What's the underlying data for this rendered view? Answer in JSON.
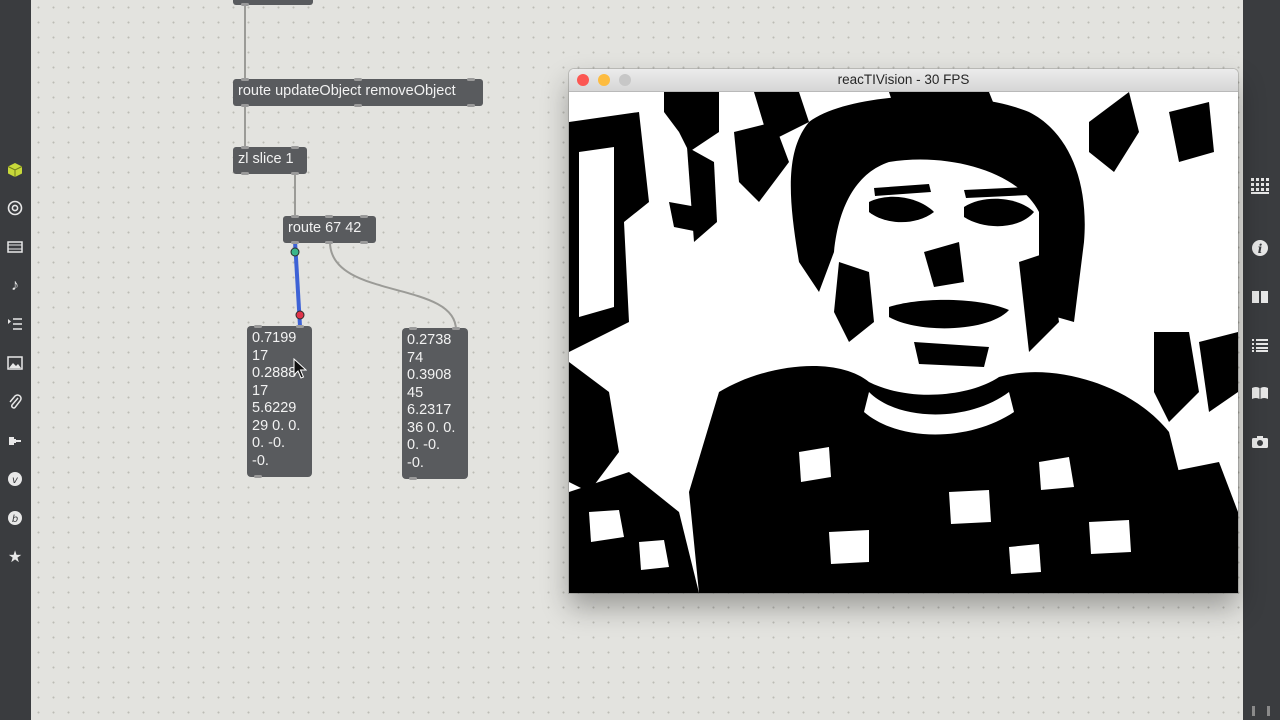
{
  "sidebar_left": {
    "icons": [
      "cube-icon",
      "target-icon",
      "film-icon",
      "music-note-icon",
      "step-list-icon",
      "image-icon",
      "paperclip-icon",
      "plugin-icon",
      "vst-icon",
      "beap-icon",
      "star-icon"
    ]
  },
  "sidebar_right": {
    "icons": [
      "grid-icon",
      "info-icon",
      "split-view-icon",
      "list-icon",
      "book-icon",
      "snapshot-icon"
    ]
  },
  "patch": {
    "objects": {
      "route_update": "route updateObject removeObject",
      "zl_slice": "zl slice 1",
      "route_67_42": "route 67 42"
    },
    "message_left": [
      "0.7199",
      "17",
      "0.2888",
      "17",
      "5.6229",
      "29 0. 0.",
      "0. -0.",
      "-0."
    ],
    "message_right": [
      "0.2738",
      "74",
      "0.3908",
      "45",
      "6.2317",
      "36 0. 0.",
      "0. -0.",
      "-0."
    ]
  },
  "video_window": {
    "title": "reacTIVision - 30 FPS",
    "colors": {
      "close": "#fc5753",
      "minimize": "#fdbc40",
      "zoom": "#c7c7c7"
    }
  }
}
